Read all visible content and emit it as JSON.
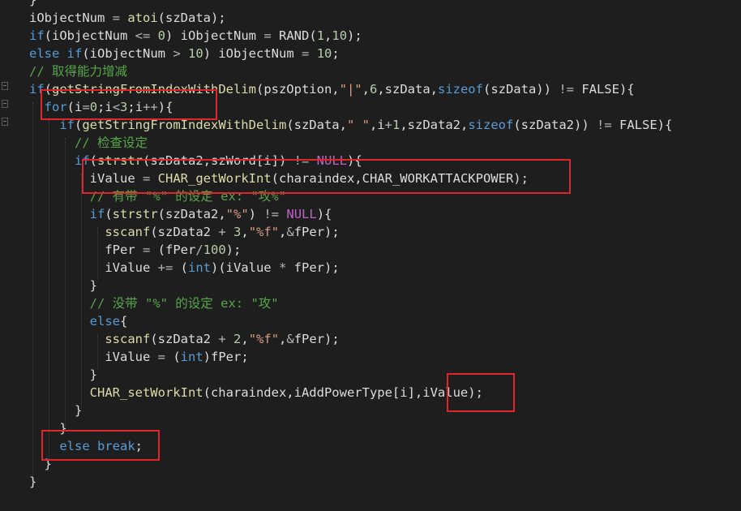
{
  "editor": {
    "colors": {
      "background": "#1e1e1e",
      "keyword": "#569cd6",
      "function": "#dcdcaa",
      "comment": "#57a64a",
      "number": "#b5cea8",
      "string": "#d69d85",
      "operator": "#b4b4b4",
      "macro": "#bd63c5",
      "identifier": "#dcdcdc",
      "highlight_box": "#e0262a"
    },
    "lines": [
      [
        [
          "}",
          "v"
        ]
      ],
      [
        [
          "iObjectNum",
          "v"
        ],
        [
          " = ",
          "o"
        ],
        [
          "atoi",
          "f"
        ],
        [
          "(szData);",
          "v"
        ]
      ],
      [
        [
          "if",
          "k"
        ],
        [
          "(iObjectNum ",
          "v"
        ],
        [
          "<=",
          "o"
        ],
        [
          " ",
          "v"
        ],
        [
          "0",
          "n"
        ],
        [
          ") iObjectNum ",
          "v"
        ],
        [
          "=",
          "o"
        ],
        [
          " RAND(",
          "v"
        ],
        [
          "1",
          "n"
        ],
        [
          ",",
          "v"
        ],
        [
          "10",
          "n"
        ],
        [
          ");",
          "v"
        ]
      ],
      [
        [
          "else",
          "k"
        ],
        [
          " ",
          "v"
        ],
        [
          "if",
          "k"
        ],
        [
          "(iObjectNum ",
          "v"
        ],
        [
          ">",
          "o"
        ],
        [
          " ",
          "v"
        ],
        [
          "10",
          "n"
        ],
        [
          ") iObjectNum ",
          "v"
        ],
        [
          "=",
          "o"
        ],
        [
          " ",
          "v"
        ],
        [
          "10",
          "n"
        ],
        [
          ";",
          "v"
        ]
      ],
      [
        [
          "// 取得能力增减",
          "c"
        ]
      ],
      [
        [
          "if",
          "k"
        ],
        [
          "(",
          "v"
        ],
        [
          "getStringFromIndexWithDelim",
          "f"
        ],
        [
          "(pszOption,",
          "v"
        ],
        [
          "\"|\"",
          "s"
        ],
        [
          ",",
          "v"
        ],
        [
          "6",
          "n"
        ],
        [
          ",szData,",
          "v"
        ],
        [
          "sizeof",
          "k"
        ],
        [
          "(szData)) ",
          "v"
        ],
        [
          "!=",
          "o"
        ],
        [
          " FALSE){",
          "v"
        ]
      ],
      [
        [
          "  ",
          "v"
        ],
        [
          "for",
          "k"
        ],
        [
          "(i",
          "v"
        ],
        [
          "=",
          "o"
        ],
        [
          "0",
          "n"
        ],
        [
          ";i",
          "v"
        ],
        [
          "<",
          "o"
        ],
        [
          "3",
          "n"
        ],
        [
          ";i",
          "v"
        ],
        [
          "++",
          "o"
        ],
        [
          "){",
          "v"
        ]
      ],
      [
        [
          "    ",
          "v"
        ],
        [
          "if",
          "k"
        ],
        [
          "(",
          "v"
        ],
        [
          "getStringFromIndexWithDelim",
          "f"
        ],
        [
          "(szData,",
          "v"
        ],
        [
          "\" \"",
          "s"
        ],
        [
          ",i",
          "v"
        ],
        [
          "+",
          "o"
        ],
        [
          "1",
          "n"
        ],
        [
          ",szData2,",
          "v"
        ],
        [
          "sizeof",
          "k"
        ],
        [
          "(szData2)) ",
          "v"
        ],
        [
          "!=",
          "o"
        ],
        [
          " FALSE){",
          "v"
        ]
      ],
      [
        [
          "      ",
          "v"
        ],
        [
          "// 检查设定",
          "c"
        ]
      ],
      [
        [
          "      ",
          "v"
        ],
        [
          "if",
          "k"
        ],
        [
          "(",
          "v"
        ],
        [
          "strstr",
          "f"
        ],
        [
          "(szData2,szWord[i]) ",
          "v"
        ],
        [
          "!=",
          "o"
        ],
        [
          " ",
          "v"
        ],
        [
          "NULL",
          "m"
        ],
        [
          "){",
          "v"
        ]
      ],
      [
        [
          "        iValue ",
          "v"
        ],
        [
          "=",
          "o"
        ],
        [
          " ",
          "v"
        ],
        [
          "CHAR_getWorkInt",
          "f"
        ],
        [
          "(charaindex,CHAR_WORKATTACKPOWER);",
          "v"
        ]
      ],
      [
        [
          "        ",
          "v"
        ],
        [
          "// 有带 \"%\" 的设定 ex: \"攻%\"",
          "c"
        ]
      ],
      [
        [
          "        ",
          "v"
        ],
        [
          "if",
          "k"
        ],
        [
          "(",
          "v"
        ],
        [
          "strstr",
          "f"
        ],
        [
          "(szData2,",
          "v"
        ],
        [
          "\"%\"",
          "s"
        ],
        [
          ") ",
          "v"
        ],
        [
          "!=",
          "o"
        ],
        [
          " ",
          "v"
        ],
        [
          "NULL",
          "m"
        ],
        [
          "){",
          "v"
        ]
      ],
      [
        [
          "          ",
          "v"
        ],
        [
          "sscanf",
          "f"
        ],
        [
          "(szData2 ",
          "v"
        ],
        [
          "+",
          "o"
        ],
        [
          " ",
          "v"
        ],
        [
          "3",
          "n"
        ],
        [
          ",",
          "v"
        ],
        [
          "\"%f\"",
          "s"
        ],
        [
          ",",
          "v"
        ],
        [
          "&",
          "o"
        ],
        [
          "fPer);",
          "v"
        ]
      ],
      [
        [
          "          fPer ",
          "v"
        ],
        [
          "=",
          "o"
        ],
        [
          " (fPer",
          "v"
        ],
        [
          "/",
          "o"
        ],
        [
          "100",
          "n"
        ],
        [
          ");",
          "v"
        ]
      ],
      [
        [
          "          iValue ",
          "v"
        ],
        [
          "+=",
          "o"
        ],
        [
          " (",
          "v"
        ],
        [
          "int",
          "k"
        ],
        [
          ")(iValue ",
          "v"
        ],
        [
          "*",
          "o"
        ],
        [
          " fPer);",
          "v"
        ]
      ],
      [
        [
          "        }",
          "v"
        ]
      ],
      [
        [
          "        ",
          "v"
        ],
        [
          "// 没带 \"%\" 的设定 ex: \"攻\"",
          "c"
        ]
      ],
      [
        [
          "        ",
          "v"
        ],
        [
          "else",
          "k"
        ],
        [
          "{",
          "v"
        ]
      ],
      [
        [
          "          ",
          "v"
        ],
        [
          "sscanf",
          "f"
        ],
        [
          "(szData2 ",
          "v"
        ],
        [
          "+",
          "o"
        ],
        [
          " ",
          "v"
        ],
        [
          "2",
          "n"
        ],
        [
          ",",
          "v"
        ],
        [
          "\"%f\"",
          "s"
        ],
        [
          ",",
          "v"
        ],
        [
          "&",
          "o"
        ],
        [
          "fPer);",
          "v"
        ]
      ],
      [
        [
          "          iValue ",
          "v"
        ],
        [
          "=",
          "o"
        ],
        [
          " (",
          "v"
        ],
        [
          "int",
          "k"
        ],
        [
          ")fPer;",
          "v"
        ]
      ],
      [
        [
          "        }",
          "v"
        ]
      ],
      [
        [
          "        ",
          "v"
        ],
        [
          "CHAR_setWorkInt",
          "f"
        ],
        [
          "(charaindex,iAddPowerType[i],iValue);",
          "v"
        ]
      ],
      [
        [
          "      }",
          "v"
        ]
      ],
      [
        [
          "    }",
          "v"
        ]
      ],
      [
        [
          "    ",
          "v"
        ],
        [
          "else",
          "k"
        ],
        [
          " ",
          "v"
        ],
        [
          "break",
          "k"
        ],
        [
          ";",
          "v"
        ]
      ],
      [
        [
          "  }",
          "v"
        ]
      ],
      [
        [
          "}",
          "v"
        ]
      ]
    ]
  }
}
